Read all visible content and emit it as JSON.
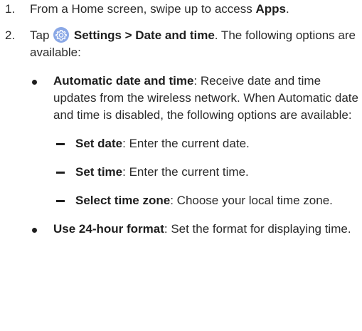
{
  "steps": [
    {
      "number": "1.",
      "prefix": "From a Home screen, swipe up to access ",
      "bold": "Apps",
      "suffix": "."
    },
    {
      "number": "2.",
      "prefix": "Tap ",
      "icon": "settings-gear-icon",
      "bold": "Settings > Date and time",
      "suffix": ". The following options are available:"
    }
  ],
  "bullets": [
    {
      "bold": "Automatic date and time",
      "text": ": Receive date and time updates from the wireless network. When Automatic date and time is disabled, the following options are available:"
    },
    {
      "bold": "Use 24-hour format",
      "text": ": Set the format for displaying time."
    }
  ],
  "subitems": [
    {
      "bold": "Set date",
      "text": ": Enter the current date."
    },
    {
      "bold": "Set time",
      "text": ": Enter the current time."
    },
    {
      "bold": "Select time zone",
      "text": ": Choose your local time zone."
    }
  ],
  "colors": {
    "text": "#2a2a2a",
    "icon_bg": "#8aa8e6",
    "icon_fg": "#ffffff"
  }
}
